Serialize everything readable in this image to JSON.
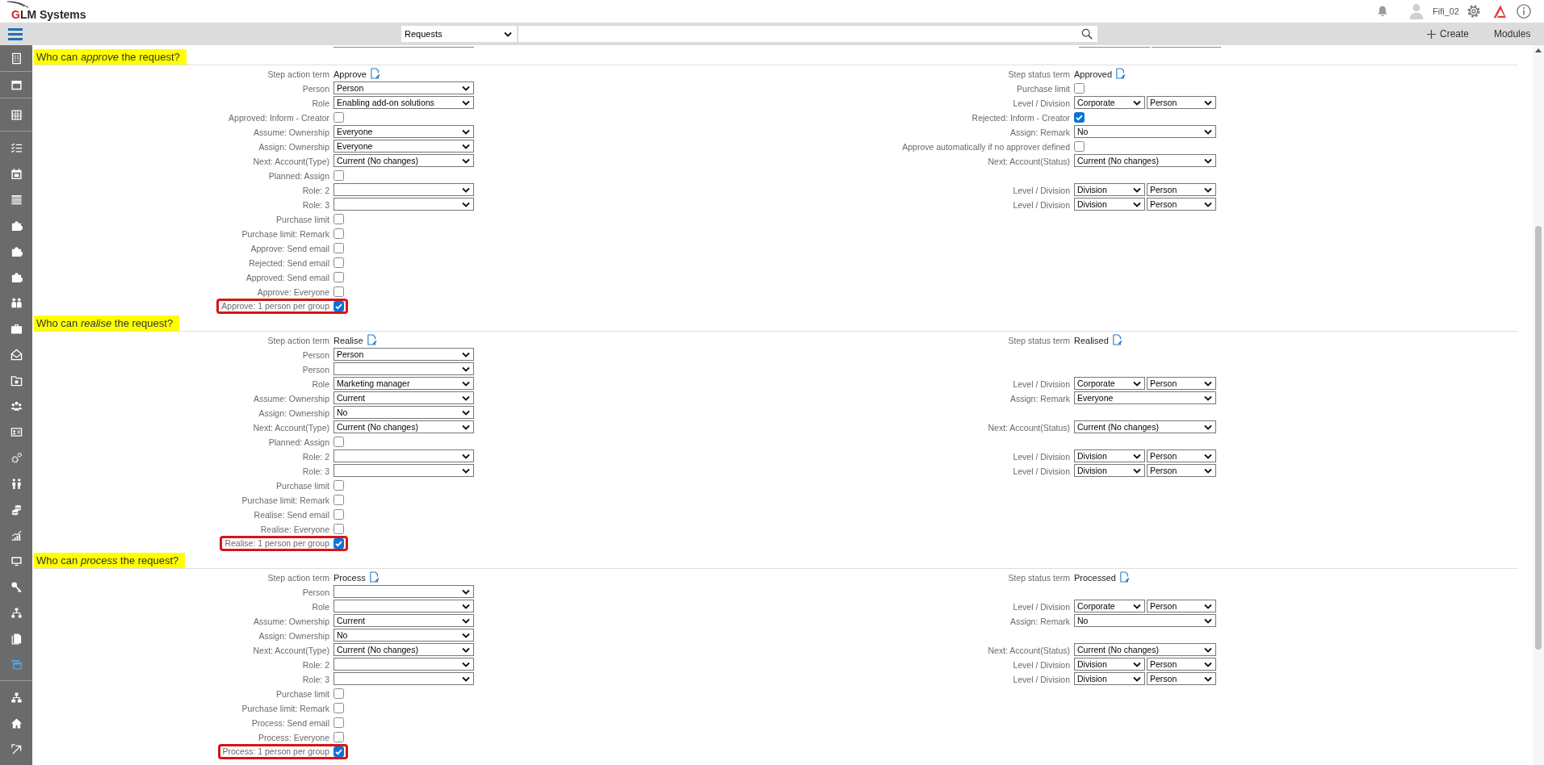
{
  "header": {
    "logo": "GLM Systems",
    "username": "Fifi_02"
  },
  "toolbar": {
    "module": "Requests",
    "create": "Create",
    "modules": "Modules"
  },
  "sidebar": {
    "groups": [
      {
        "items": [
          {
            "selected": false
          }
        ]
      },
      {
        "items": [
          {
            "selected": false
          }
        ]
      },
      {
        "items": [
          {
            "selected": false
          }
        ]
      },
      {
        "items": [
          {
            "selected": false
          },
          {
            "selected": false
          },
          {
            "selected": false
          },
          {
            "selected": false
          },
          {
            "selected": false
          },
          {
            "selected": false
          },
          {
            "selected": false
          },
          {
            "selected": false
          },
          {
            "selected": false
          },
          {
            "selected": false
          },
          {
            "selected": false
          },
          {
            "selected": false
          },
          {
            "selected": false
          },
          {
            "selected": false
          },
          {
            "selected": false
          },
          {
            "selected": false
          },
          {
            "selected": false
          },
          {
            "selected": false
          },
          {
            "selected": false
          },
          {
            "selected": false
          },
          {
            "selected": true
          }
        ]
      },
      {
        "items": [
          {
            "selected": false
          },
          {
            "selected": false
          },
          {
            "selected": false
          }
        ]
      }
    ]
  },
  "sections": [
    {
      "heading": "Who can *approve* the request?",
      "rows": [
        {
          "left": {
            "kind": "term",
            "label": "Step action term",
            "value": "Approve"
          },
          "right": {
            "kind": "term",
            "label": "Step status term",
            "value": "Approved"
          }
        },
        {
          "left": {
            "kind": "select",
            "label": "Person",
            "value": "Person"
          },
          "right": {
            "kind": "checkbox",
            "label": "Purchase limit",
            "checked": false,
            "highlighted": false
          }
        },
        {
          "left": {
            "kind": "select",
            "label": "Role",
            "value": "Enabling add-on solutions"
          },
          "right": {
            "kind": "select_pair",
            "label": "Level / Division",
            "values": [
              "Corporate",
              "Person"
            ]
          }
        },
        {
          "left": {
            "kind": "checkbox",
            "label": "Approved: Inform - Creator",
            "checked": false,
            "highlighted": false
          },
          "right": {
            "kind": "checkbox",
            "label": "Rejected: Inform - Creator",
            "checked": true,
            "highlighted": false
          }
        },
        {
          "left": {
            "kind": "select",
            "label": "Assume: Ownership",
            "value": "Everyone"
          },
          "right": {
            "kind": "select",
            "label": "Assign: Remark",
            "value": "No"
          }
        },
        {
          "left": {
            "kind": "select",
            "label": "Assign: Ownership",
            "value": "Everyone"
          },
          "right": {
            "kind": "checkbox",
            "label": "Approve automatically if no approver defined",
            "checked": false,
            "highlighted": false
          }
        },
        {
          "left": {
            "kind": "select",
            "label": "Next: Account(Type)",
            "value": "Current (No changes)"
          },
          "right": {
            "kind": "select",
            "label": "Next: Account(Status)",
            "value": "Current (No changes)"
          }
        },
        {
          "left": {
            "kind": "checkbox",
            "label": "Planned: Assign",
            "checked": false,
            "highlighted": false
          }
        },
        {
          "left": {
            "kind": "select",
            "label": "Role: 2"
          },
          "right": {
            "kind": "select_pair",
            "label": "Level / Division",
            "values": [
              "Division",
              "Person"
            ]
          }
        },
        {
          "left": {
            "kind": "select",
            "label": "Role: 3"
          },
          "right": {
            "kind": "select_pair",
            "label": "Level / Division",
            "values": [
              "Division",
              "Person"
            ]
          }
        },
        {
          "left": {
            "kind": "checkbox",
            "label": "Purchase limit",
            "checked": false,
            "highlighted": false
          }
        },
        {
          "left": {
            "kind": "checkbox",
            "label": "Purchase limit: Remark",
            "checked": false,
            "highlighted": false
          }
        },
        {
          "left": {
            "kind": "checkbox",
            "label": "Approve: Send email",
            "checked": false,
            "highlighted": false
          }
        },
        {
          "left": {
            "kind": "checkbox",
            "label": "Rejected: Send email",
            "checked": false,
            "highlighted": false
          }
        },
        {
          "left": {
            "kind": "checkbox",
            "label": "Approved: Send email",
            "checked": false,
            "highlighted": false
          }
        },
        {
          "left": {
            "kind": "checkbox",
            "label": "Approve: Everyone",
            "checked": false,
            "highlighted": false
          }
        },
        {
          "left": {
            "kind": "checkbox",
            "label": "Approve: 1 person per group",
            "checked": true,
            "highlighted": true
          }
        }
      ]
    },
    {
      "heading": "Who can *realise* the request?",
      "rows": [
        {
          "left": {
            "kind": "term",
            "label": "Step action term",
            "value": "Realise"
          },
          "right": {
            "kind": "term",
            "label": "Step status term",
            "value": "Realised"
          }
        },
        {
          "left": {
            "kind": "select",
            "label": "Person",
            "value": "Person"
          }
        },
        {
          "left": {
            "kind": "select",
            "label": "Person"
          }
        },
        {
          "left": {
            "kind": "select",
            "label": "Role",
            "value": "Marketing manager"
          },
          "right": {
            "kind": "select_pair",
            "label": "Level / Division",
            "values": [
              "Corporate",
              "Person"
            ]
          }
        },
        {
          "left": {
            "kind": "select",
            "label": "Assume: Ownership",
            "value": "Current"
          },
          "right": {
            "kind": "select",
            "label": "Assign: Remark",
            "value": "Everyone"
          }
        },
        {
          "left": {
            "kind": "select",
            "label": "Assign: Ownership",
            "value": "No"
          }
        },
        {
          "left": {
            "kind": "select",
            "label": "Next: Account(Type)",
            "value": "Current (No changes)"
          },
          "right": {
            "kind": "select",
            "label": "Next: Account(Status)",
            "value": "Current (No changes)"
          }
        },
        {
          "left": {
            "kind": "checkbox",
            "label": "Planned: Assign",
            "checked": false,
            "highlighted": false
          }
        },
        {
          "left": {
            "kind": "select",
            "label": "Role: 2"
          },
          "right": {
            "kind": "select_pair",
            "label": "Level / Division",
            "values": [
              "Division",
              "Person"
            ]
          }
        },
        {
          "left": {
            "kind": "select",
            "label": "Role: 3"
          },
          "right": {
            "kind": "select_pair",
            "label": "Level / Division",
            "values": [
              "Division",
              "Person"
            ]
          }
        },
        {
          "left": {
            "kind": "checkbox",
            "label": "Purchase limit",
            "checked": false,
            "highlighted": false
          }
        },
        {
          "left": {
            "kind": "checkbox",
            "label": "Purchase limit: Remark",
            "checked": false,
            "highlighted": false
          }
        },
        {
          "left": {
            "kind": "checkbox",
            "label": "Realise: Send email",
            "checked": false,
            "highlighted": false
          }
        },
        {
          "left": {
            "kind": "checkbox",
            "label": "Realise: Everyone",
            "checked": false,
            "highlighted": false
          }
        },
        {
          "left": {
            "kind": "checkbox",
            "label": "Realise: 1 person per group",
            "checked": true,
            "highlighted": true
          }
        }
      ]
    },
    {
      "heading": "Who can *process* the request?",
      "rows": [
        {
          "left": {
            "kind": "term",
            "label": "Step action term",
            "value": "Process"
          },
          "right": {
            "kind": "term",
            "label": "Step status term",
            "value": "Processed"
          }
        },
        {
          "left": {
            "kind": "select",
            "label": "Person"
          }
        },
        {
          "left": {
            "kind": "select",
            "label": "Role"
          },
          "right": {
            "kind": "select_pair",
            "label": "Level / Division",
            "values": [
              "Corporate",
              "Person"
            ]
          }
        },
        {
          "left": {
            "kind": "select",
            "label": "Assume: Ownership",
            "value": "Current"
          },
          "right": {
            "kind": "select",
            "label": "Assign: Remark",
            "value": "No"
          }
        },
        {
          "left": {
            "kind": "select",
            "label": "Assign: Ownership",
            "value": "No"
          }
        },
        {
          "left": {
            "kind": "select",
            "label": "Next: Account(Type)",
            "value": "Current (No changes)"
          },
          "right": {
            "kind": "select",
            "label": "Next: Account(Status)",
            "value": "Current (No changes)"
          }
        },
        {
          "left": {
            "kind": "select",
            "label": "Role: 2"
          },
          "right": {
            "kind": "select_pair",
            "label": "Level / Division",
            "values": [
              "Division",
              "Person"
            ]
          }
        },
        {
          "left": {
            "kind": "select",
            "label": "Role: 3"
          },
          "right": {
            "kind": "select_pair",
            "label": "Level / Division",
            "values": [
              "Division",
              "Person"
            ]
          }
        },
        {
          "left": {
            "kind": "checkbox",
            "label": "Purchase limit",
            "checked": false,
            "highlighted": false
          }
        },
        {
          "left": {
            "kind": "checkbox",
            "label": "Purchase limit: Remark",
            "checked": false,
            "highlighted": false
          }
        },
        {
          "left": {
            "kind": "checkbox",
            "label": "Process: Send email",
            "checked": false,
            "highlighted": false
          }
        },
        {
          "left": {
            "kind": "checkbox",
            "label": "Process: Everyone",
            "checked": false,
            "highlighted": false
          }
        },
        {
          "left": {
            "kind": "checkbox",
            "label": "Process: 1 person per group",
            "checked": true,
            "highlighted": true
          }
        }
      ]
    }
  ]
}
